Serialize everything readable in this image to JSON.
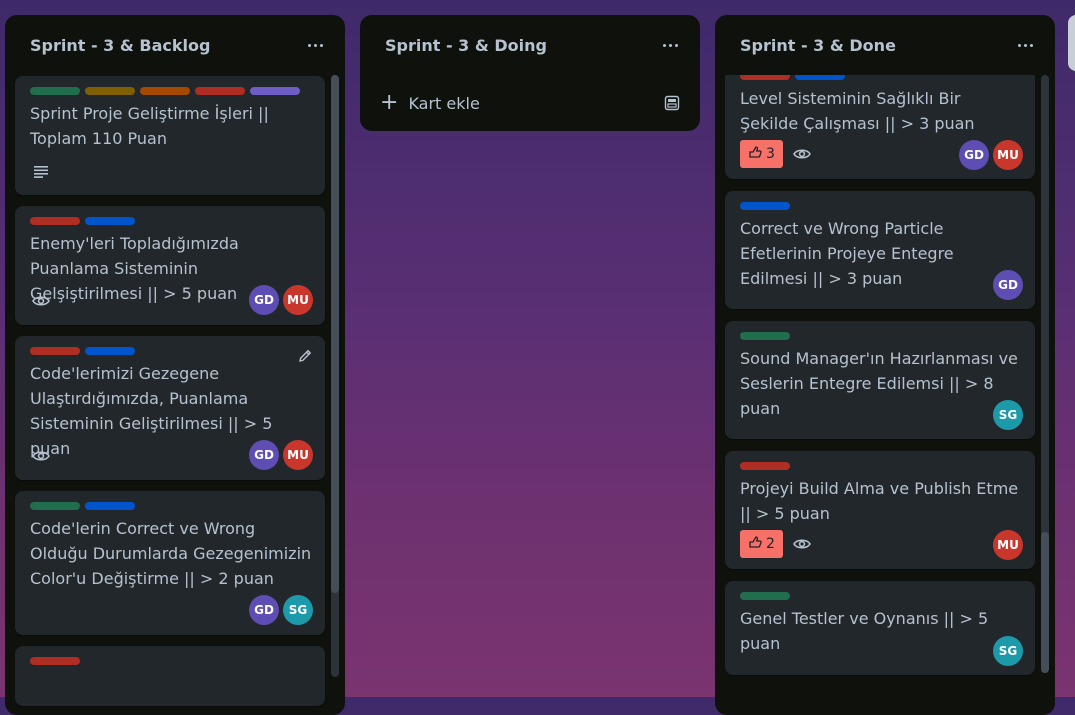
{
  "colors": {
    "green": "#216e4e",
    "yellow": "#7f5f01",
    "orange": "#a54800",
    "red": "#ae2e24",
    "purple": "#6e5dc6",
    "blue": "#0055cc",
    "avatar_gd": "#5e4db2",
    "avatar_mu": "#c9372c",
    "avatar_sg": "#1d9aaa",
    "vote_bg": "#f87168"
  },
  "lists": {
    "backlog": {
      "title": "Sprint - 3 & Backlog",
      "cards": [
        {
          "labels": [
            "green",
            "yellow",
            "orange",
            "red",
            "purple"
          ],
          "title": "Sprint Proje Geliştirme İşleri || Toplam 110 Puan",
          "badges": [
            "description-icon"
          ],
          "members": []
        },
        {
          "labels": [
            "red",
            "blue"
          ],
          "title": "Enemy'leri Topladığımızda Puanlama Sisteminin Gelşiştirilmesi || > 5 puan",
          "badges": [
            "eye-icon"
          ],
          "members": [
            "GD",
            "MU"
          ]
        },
        {
          "labels": [
            "red",
            "blue"
          ],
          "title": "Code'lerimizi Gezegene Ulaştırdığımızda, Puanlama Sisteminin Geliştirilmesi || > 5 puan",
          "badges": [
            "eye-icon"
          ],
          "members": [
            "GD",
            "MU"
          ]
        },
        {
          "labels": [
            "green",
            "blue"
          ],
          "title": "Code'lerin Correct ve Wrong Olduğu Durumlarda Gezegenimizin Color'u Değiştirme || > 2 puan",
          "badges": [],
          "members": [
            "GD",
            "SG"
          ]
        },
        {
          "labels": [
            "red"
          ],
          "title": "",
          "badges": [],
          "members": []
        }
      ]
    },
    "doing": {
      "title": "Sprint - 3 & Doing",
      "add_card_label": "Kart ekle"
    },
    "done": {
      "title": "Sprint - 3 & Done",
      "cards": [
        {
          "labels": [
            "red",
            "blue"
          ],
          "title": "Level Sisteminin Sağlıklı Bir Şekilde Çalışması || > 3 puan",
          "votes": "3",
          "badges": [
            "eye-icon"
          ],
          "members": [
            "GD",
            "MU"
          ]
        },
        {
          "labels": [
            "blue"
          ],
          "title": "Correct ve Wrong Particle Efetlerinin Projeye Entegre Edilmesi || > 3 puan",
          "badges": [],
          "members": [
            "GD"
          ]
        },
        {
          "labels": [
            "green"
          ],
          "title": "Sound Manager'ın Hazırlanması ve Seslerin Entegre Edilemsi || > 8 puan",
          "badges": [],
          "members": [
            "SG"
          ]
        },
        {
          "labels": [
            "red"
          ],
          "title": "Projeyi Build Alma ve Publish Etme || > 5 puan",
          "votes": "2",
          "badges": [
            "eye-icon"
          ],
          "members": [
            "MU"
          ]
        },
        {
          "labels": [
            "green"
          ],
          "title": "Genel Testler ve Oynanıs || > 5 puan",
          "badges": [],
          "members": [
            "SG"
          ]
        }
      ]
    }
  }
}
